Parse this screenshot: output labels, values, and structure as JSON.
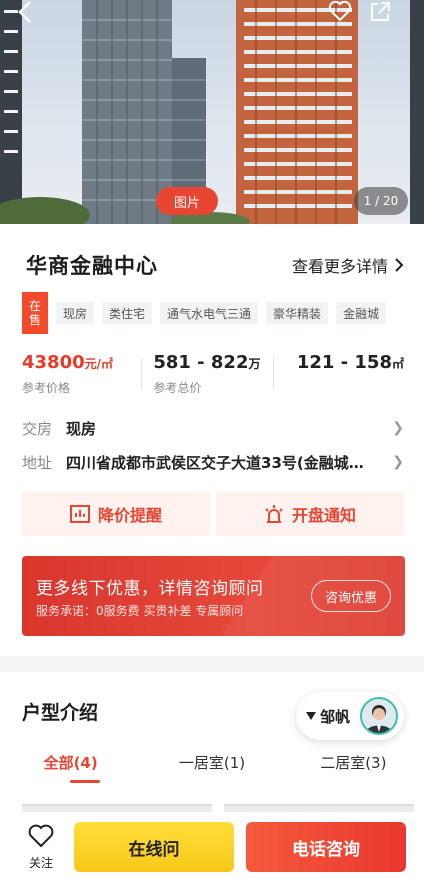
{
  "hero": {
    "photo_tag": "图片",
    "photo_count": "1 / 20"
  },
  "project": {
    "name": "华商金融中心",
    "more_details": "查看更多详情",
    "sale_status": "在售",
    "tags": [
      "现房",
      "类住宅",
      "通气水电气三通",
      "豪华精装",
      "金融城"
    ]
  },
  "stats": {
    "unit_price": {
      "value": "43800",
      "unit": "元/㎡",
      "label": "参考价格"
    },
    "total_price": {
      "value": "581 - 822",
      "unit": "万",
      "label": "参考总价"
    },
    "area": {
      "value": "121 - 158",
      "unit": "㎡"
    }
  },
  "details": {
    "delivery_label": "交房",
    "delivery_value": "现房",
    "address_label": "地址",
    "address_value": "四川省成都市武侯区交子大道33号(金融城…"
  },
  "actions": {
    "price_drop": "降价提醒",
    "opening_notice": "开盘通知"
  },
  "promo": {
    "title": "更多线下优惠，详情咨询顾问",
    "subtitle": "服务承诺：0服务费 买贵补差 专属顾问",
    "button": "咨询优惠"
  },
  "layouts": {
    "title": "户型介绍",
    "agent_name": "邹帆",
    "tabs": [
      "全部(4)",
      "一居室(1)",
      "二居室(3)"
    ]
  },
  "bottom_bar": {
    "favorite": "关注",
    "online_chat": "在线问",
    "phone_consult": "电话咨询"
  },
  "colors": {
    "accent": "#e64632",
    "price_red": "#e63b28",
    "chat_yellow": "#f7c81a"
  }
}
